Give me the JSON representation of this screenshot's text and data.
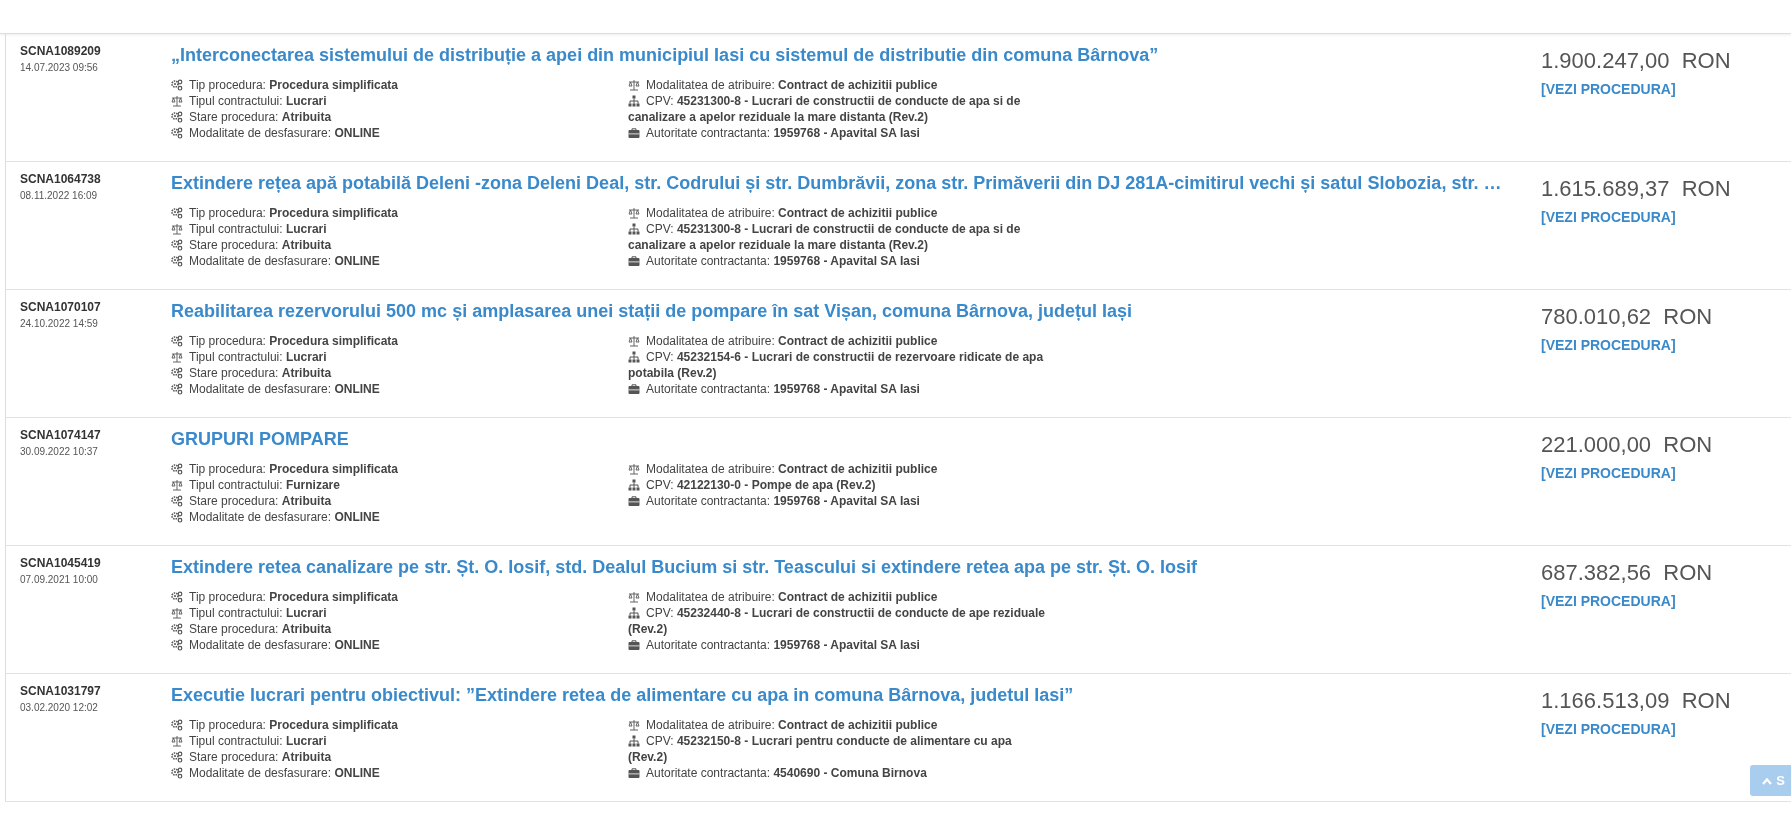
{
  "rows": [
    {
      "code": "SCNA1089209",
      "date": "14.07.2023 09:56",
      "title": "„Interconectarea sistemului de distribuție a apei din municipiul Iasi cu sistemul de distributie din comuna Bârnova”",
      "amount": "1.900.247,00",
      "currency": "RON",
      "link": "[VEZI PROCEDURA]",
      "left": [
        {
          "kind": "procedure",
          "label": "Tip procedura:",
          "value": "Procedura simplificata"
        },
        {
          "kind": "contract",
          "label": "Tipul contractului:",
          "value": "Lucrari"
        },
        {
          "kind": "status",
          "label": "Stare procedura:",
          "value": "Atribuita"
        },
        {
          "kind": "mode",
          "label": "Modalitate de desfasurare:",
          "value": "ONLINE"
        }
      ],
      "right": [
        {
          "kind": "award",
          "label": "Modalitatea de atribuire:",
          "value": "Contract de achizitii publice"
        },
        {
          "kind": "cpv",
          "label": "CPV:",
          "value": "45231300-8 - Lucrari de constructii de conducte de apa si de canalizare a apelor reziduale la mare distanta (Rev.2)"
        },
        {
          "kind": "authority",
          "label": "Autoritate contractanta:",
          "value": "1959768 - Apavital SA Iasi"
        }
      ]
    },
    {
      "code": "SCNA1064738",
      "date": "08.11.2022 16:09",
      "title": "Extindere rețea apă potabilă Deleni -zona Deleni Deal, str. Codrului și str. Dumbrăvii, zona str. Primăverii din DJ 281A-cimitirul vechi și satul Slobozia, str. …",
      "amount": "1.615.689,37",
      "currency": "RON",
      "link": "[VEZI PROCEDURA]",
      "left": [
        {
          "kind": "procedure",
          "label": "Tip procedura:",
          "value": "Procedura simplificata"
        },
        {
          "kind": "contract",
          "label": "Tipul contractului:",
          "value": "Lucrari"
        },
        {
          "kind": "status",
          "label": "Stare procedura:",
          "value": "Atribuita"
        },
        {
          "kind": "mode",
          "label": "Modalitate de desfasurare:",
          "value": "ONLINE"
        }
      ],
      "right": [
        {
          "kind": "award",
          "label": "Modalitatea de atribuire:",
          "value": "Contract de achizitii publice"
        },
        {
          "kind": "cpv",
          "label": "CPV:",
          "value": "45231300-8 - Lucrari de constructii de conducte de apa si de canalizare a apelor reziduale la mare distanta (Rev.2)"
        },
        {
          "kind": "authority",
          "label": "Autoritate contractanta:",
          "value": "1959768 - Apavital SA Iasi"
        }
      ]
    },
    {
      "code": "SCNA1070107",
      "date": "24.10.2022 14:59",
      "title": "Reabilitarea rezervorului 500 mc și amplasarea unei stații de pompare în sat Vișan, comuna Bârnova, județul Iași",
      "amount": "780.010,62",
      "currency": "RON",
      "link": "[VEZI PROCEDURA]",
      "left": [
        {
          "kind": "procedure",
          "label": "Tip procedura:",
          "value": "Procedura simplificata"
        },
        {
          "kind": "contract",
          "label": "Tipul contractului:",
          "value": "Lucrari"
        },
        {
          "kind": "status",
          "label": "Stare procedura:",
          "value": "Atribuita"
        },
        {
          "kind": "mode",
          "label": "Modalitate de desfasurare:",
          "value": "ONLINE"
        }
      ],
      "right": [
        {
          "kind": "award",
          "label": "Modalitatea de atribuire:",
          "value": "Contract de achizitii publice"
        },
        {
          "kind": "cpv",
          "label": "CPV:",
          "value": "45232154-6 - Lucrari de constructii de rezervoare ridicate de apa potabila (Rev.2)"
        },
        {
          "kind": "authority",
          "label": "Autoritate contractanta:",
          "value": "1959768 - Apavital SA Iasi"
        }
      ]
    },
    {
      "code": "SCNA1074147",
      "date": "30.09.2022 10:37",
      "title": "GRUPURI POMPARE",
      "amount": "221.000,00",
      "currency": "RON",
      "link": "[VEZI PROCEDURA]",
      "left": [
        {
          "kind": "procedure",
          "label": "Tip procedura:",
          "value": "Procedura simplificata"
        },
        {
          "kind": "contract",
          "label": "Tipul contractului:",
          "value": "Furnizare"
        },
        {
          "kind": "status",
          "label": "Stare procedura:",
          "value": "Atribuita"
        },
        {
          "kind": "mode",
          "label": "Modalitate de desfasurare:",
          "value": "ONLINE"
        }
      ],
      "right": [
        {
          "kind": "award",
          "label": "Modalitatea de atribuire:",
          "value": "Contract de achizitii publice"
        },
        {
          "kind": "cpv",
          "label": "CPV:",
          "value": "42122130-0 - Pompe de apa (Rev.2)"
        },
        {
          "kind": "authority",
          "label": "Autoritate contractanta:",
          "value": "1959768 - Apavital SA Iasi"
        }
      ]
    },
    {
      "code": "SCNA1045419",
      "date": "07.09.2021 10:00",
      "title": "Extindere retea canalizare pe str. Șt. O. Iosif, std. Dealul Bucium si str. Teascului si extindere retea apa pe str. Șt. O. Iosif",
      "amount": "687.382,56",
      "currency": "RON",
      "link": "[VEZI PROCEDURA]",
      "left": [
        {
          "kind": "procedure",
          "label": "Tip procedura:",
          "value": "Procedura simplificata"
        },
        {
          "kind": "contract",
          "label": "Tipul contractului:",
          "value": "Lucrari"
        },
        {
          "kind": "status",
          "label": "Stare procedura:",
          "value": "Atribuita"
        },
        {
          "kind": "mode",
          "label": "Modalitate de desfasurare:",
          "value": "ONLINE"
        }
      ],
      "right": [
        {
          "kind": "award",
          "label": "Modalitatea de atribuire:",
          "value": "Contract de achizitii publice"
        },
        {
          "kind": "cpv",
          "label": "CPV:",
          "value": "45232440-8 - Lucrari de constructii de conducte de ape reziduale (Rev.2)"
        },
        {
          "kind": "authority",
          "label": "Autoritate contractanta:",
          "value": "1959768 - Apavital SA Iasi"
        }
      ]
    },
    {
      "code": "SCNA1031797",
      "date": "03.02.2020 12:02",
      "title": "Executie lucrari pentru obiectivul: ”Extindere retea de alimentare cu apa in comuna Bârnova, judetul Iasi”",
      "amount": "1.166.513,09",
      "currency": "RON",
      "link": "[VEZI PROCEDURA]",
      "left": [
        {
          "kind": "procedure",
          "label": "Tip procedura:",
          "value": "Procedura simplificata"
        },
        {
          "kind": "contract",
          "label": "Tipul contractului:",
          "value": "Lucrari"
        },
        {
          "kind": "status",
          "label": "Stare procedura:",
          "value": "Atribuita"
        },
        {
          "kind": "mode",
          "label": "Modalitate de desfasurare:",
          "value": "ONLINE"
        }
      ],
      "right": [
        {
          "kind": "award",
          "label": "Modalitatea de atribuire:",
          "value": "Contract de achizitii publice"
        },
        {
          "kind": "cpv",
          "label": "CPV:",
          "value": "45232150-8 - Lucrari pentru conducte de alimentare cu apa (Rev.2)"
        },
        {
          "kind": "authority",
          "label": "Autoritate contractanta:",
          "value": "4540690 - Comuna Birnova"
        }
      ]
    }
  ],
  "scroll_top": {
    "label": "S"
  }
}
